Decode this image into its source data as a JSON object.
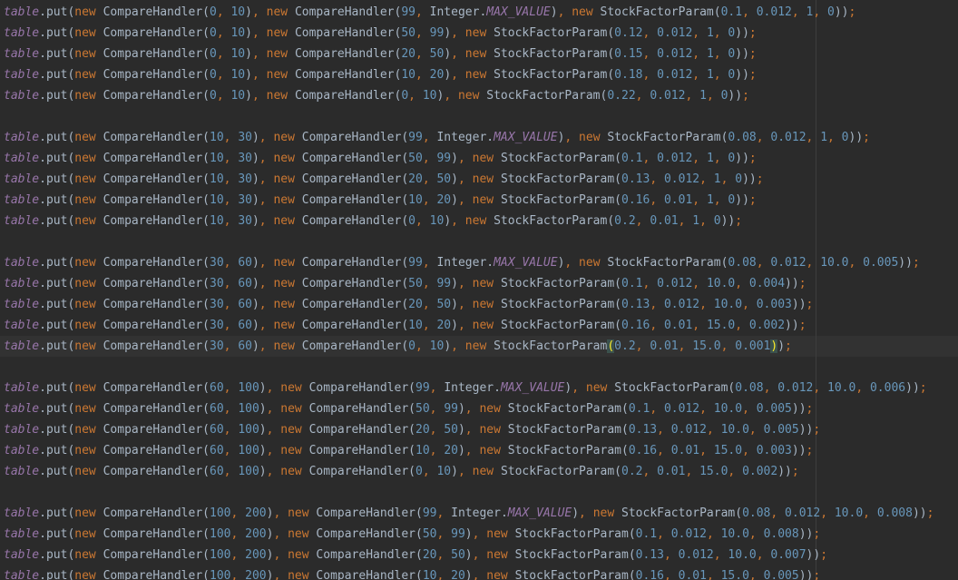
{
  "editor": {
    "lines": [
      {
        "map_var": "table",
        "method": "put",
        "kw": "new",
        "cls_a": "CompareHandler",
        "a1": "0",
        "a2": "10",
        "cls_b": "CompareHandler",
        "b1": "99",
        "b2_type": "Integer",
        "b2_const": "MAX_VALUE",
        "b2": "",
        "cls_c": "StockFactorParam",
        "c1": "0.1",
        "c2": "0.012",
        "c3": "1",
        "c4": "0"
      },
      {
        "map_var": "table",
        "method": "put",
        "kw": "new",
        "cls_a": "CompareHandler",
        "a1": "0",
        "a2": "10",
        "cls_b": "CompareHandler",
        "b1": "50",
        "b2_type": "",
        "b2_const": "",
        "b2": "99",
        "cls_c": "StockFactorParam",
        "c1": "0.12",
        "c2": "0.012",
        "c3": "1",
        "c4": "0"
      },
      {
        "map_var": "table",
        "method": "put",
        "kw": "new",
        "cls_a": "CompareHandler",
        "a1": "0",
        "a2": "10",
        "cls_b": "CompareHandler",
        "b1": "20",
        "b2_type": "",
        "b2_const": "",
        "b2": "50",
        "cls_c": "StockFactorParam",
        "c1": "0.15",
        "c2": "0.012",
        "c3": "1",
        "c4": "0"
      },
      {
        "map_var": "table",
        "method": "put",
        "kw": "new",
        "cls_a": "CompareHandler",
        "a1": "0",
        "a2": "10",
        "cls_b": "CompareHandler",
        "b1": "10",
        "b2_type": "",
        "b2_const": "",
        "b2": "20",
        "cls_c": "StockFactorParam",
        "c1": "0.18",
        "c2": "0.012",
        "c3": "1",
        "c4": "0"
      },
      {
        "map_var": "table",
        "method": "put",
        "kw": "new",
        "cls_a": "CompareHandler",
        "a1": "0",
        "a2": "10",
        "cls_b": "CompareHandler",
        "b1": "0",
        "b2_type": "",
        "b2_const": "",
        "b2": "10",
        "cls_c": "StockFactorParam",
        "c1": "0.22",
        "c2": "0.012",
        "c3": "1",
        "c4": "0"
      },
      null,
      {
        "map_var": "table",
        "method": "put",
        "kw": "new",
        "cls_a": "CompareHandler",
        "a1": "10",
        "a2": "30",
        "cls_b": "CompareHandler",
        "b1": "99",
        "b2_type": "Integer",
        "b2_const": "MAX_VALUE",
        "b2": "",
        "cls_c": "StockFactorParam",
        "c1": "0.08",
        "c2": "0.012",
        "c3": "1",
        "c4": "0"
      },
      {
        "map_var": "table",
        "method": "put",
        "kw": "new",
        "cls_a": "CompareHandler",
        "a1": "10",
        "a2": "30",
        "cls_b": "CompareHandler",
        "b1": "50",
        "b2_type": "",
        "b2_const": "",
        "b2": "99",
        "cls_c": "StockFactorParam",
        "c1": "0.1",
        "c2": "0.012",
        "c3": "1",
        "c4": "0"
      },
      {
        "map_var": "table",
        "method": "put",
        "kw": "new",
        "cls_a": "CompareHandler",
        "a1": "10",
        "a2": "30",
        "cls_b": "CompareHandler",
        "b1": "20",
        "b2_type": "",
        "b2_const": "",
        "b2": "50",
        "cls_c": "StockFactorParam",
        "c1": "0.13",
        "c2": "0.012",
        "c3": "1",
        "c4": "0"
      },
      {
        "map_var": "table",
        "method": "put",
        "kw": "new",
        "cls_a": "CompareHandler",
        "a1": "10",
        "a2": "30",
        "cls_b": "CompareHandler",
        "b1": "10",
        "b2_type": "",
        "b2_const": "",
        "b2": "20",
        "cls_c": "StockFactorParam",
        "c1": "0.16",
        "c2": "0.01",
        "c3": "1",
        "c4": "0"
      },
      {
        "map_var": "table",
        "method": "put",
        "kw": "new",
        "cls_a": "CompareHandler",
        "a1": "10",
        "a2": "30",
        "cls_b": "CompareHandler",
        "b1": "0",
        "b2_type": "",
        "b2_const": "",
        "b2": "10",
        "cls_c": "StockFactorParam",
        "c1": "0.2",
        "c2": "0.01",
        "c3": "1",
        "c4": "0"
      },
      null,
      {
        "map_var": "table",
        "method": "put",
        "kw": "new",
        "cls_a": "CompareHandler",
        "a1": "30",
        "a2": "60",
        "cls_b": "CompareHandler",
        "b1": "99",
        "b2_type": "Integer",
        "b2_const": "MAX_VALUE",
        "b2": "",
        "cls_c": "StockFactorParam",
        "c1": "0.08",
        "c2": "0.012",
        "c3": "10.0",
        "c4": "0.005"
      },
      {
        "map_var": "table",
        "method": "put",
        "kw": "new",
        "cls_a": "CompareHandler",
        "a1": "30",
        "a2": "60",
        "cls_b": "CompareHandler",
        "b1": "50",
        "b2_type": "",
        "b2_const": "",
        "b2": "99",
        "cls_c": "StockFactorParam",
        "c1": "0.1",
        "c2": "0.012",
        "c3": "10.0",
        "c4": "0.004"
      },
      {
        "map_var": "table",
        "method": "put",
        "kw": "new",
        "cls_a": "CompareHandler",
        "a1": "30",
        "a2": "60",
        "cls_b": "CompareHandler",
        "b1": "20",
        "b2_type": "",
        "b2_const": "",
        "b2": "50",
        "cls_c": "StockFactorParam",
        "c1": "0.13",
        "c2": "0.012",
        "c3": "10.0",
        "c4": "0.003"
      },
      {
        "map_var": "table",
        "method": "put",
        "kw": "new",
        "cls_a": "CompareHandler",
        "a1": "30",
        "a2": "60",
        "cls_b": "CompareHandler",
        "b1": "10",
        "b2_type": "",
        "b2_const": "",
        "b2": "20",
        "cls_c": "StockFactorParam",
        "c1": "0.16",
        "c2": "0.01",
        "c3": "15.0",
        "c4": "0.002"
      },
      {
        "map_var": "table",
        "method": "put",
        "kw": "new",
        "cls_a": "CompareHandler",
        "a1": "30",
        "a2": "60",
        "cls_b": "CompareHandler",
        "b1": "0",
        "b2_type": "",
        "b2_const": "",
        "b2": "10",
        "cls_c": "StockFactorParam",
        "c1": "0.2",
        "c2": "0.01",
        "c3": "15.0",
        "c4": "0.001",
        "current": true
      },
      null,
      {
        "map_var": "table",
        "method": "put",
        "kw": "new",
        "cls_a": "CompareHandler",
        "a1": "60",
        "a2": "100",
        "cls_b": "CompareHandler",
        "b1": "99",
        "b2_type": "Integer",
        "b2_const": "MAX_VALUE",
        "b2": "",
        "cls_c": "StockFactorParam",
        "c1": "0.08",
        "c2": "0.012",
        "c3": "10.0",
        "c4": "0.006"
      },
      {
        "map_var": "table",
        "method": "put",
        "kw": "new",
        "cls_a": "CompareHandler",
        "a1": "60",
        "a2": "100",
        "cls_b": "CompareHandler",
        "b1": "50",
        "b2_type": "",
        "b2_const": "",
        "b2": "99",
        "cls_c": "StockFactorParam",
        "c1": "0.1",
        "c2": "0.012",
        "c3": "10.0",
        "c4": "0.005"
      },
      {
        "map_var": "table",
        "method": "put",
        "kw": "new",
        "cls_a": "CompareHandler",
        "a1": "60",
        "a2": "100",
        "cls_b": "CompareHandler",
        "b1": "20",
        "b2_type": "",
        "b2_const": "",
        "b2": "50",
        "cls_c": "StockFactorParam",
        "c1": "0.13",
        "c2": "0.012",
        "c3": "10.0",
        "c4": "0.005"
      },
      {
        "map_var": "table",
        "method": "put",
        "kw": "new",
        "cls_a": "CompareHandler",
        "a1": "60",
        "a2": "100",
        "cls_b": "CompareHandler",
        "b1": "10",
        "b2_type": "",
        "b2_const": "",
        "b2": "20",
        "cls_c": "StockFactorParam",
        "c1": "0.16",
        "c2": "0.01",
        "c3": "15.0",
        "c4": "0.003"
      },
      {
        "map_var": "table",
        "method": "put",
        "kw": "new",
        "cls_a": "CompareHandler",
        "a1": "60",
        "a2": "100",
        "cls_b": "CompareHandler",
        "b1": "0",
        "b2_type": "",
        "b2_const": "",
        "b2": "10",
        "cls_c": "StockFactorParam",
        "c1": "0.2",
        "c2": "0.01",
        "c3": "15.0",
        "c4": "0.002"
      },
      null,
      {
        "map_var": "table",
        "method": "put",
        "kw": "new",
        "cls_a": "CompareHandler",
        "a1": "100",
        "a2": "200",
        "cls_b": "CompareHandler",
        "b1": "99",
        "b2_type": "Integer",
        "b2_const": "MAX_VALUE",
        "b2": "",
        "cls_c": "StockFactorParam",
        "c1": "0.08",
        "c2": "0.012",
        "c3": "10.0",
        "c4": "0.008"
      },
      {
        "map_var": "table",
        "method": "put",
        "kw": "new",
        "cls_a": "CompareHandler",
        "a1": "100",
        "a2": "200",
        "cls_b": "CompareHandler",
        "b1": "50",
        "b2_type": "",
        "b2_const": "",
        "b2": "99",
        "cls_c": "StockFactorParam",
        "c1": "0.1",
        "c2": "0.012",
        "c3": "10.0",
        "c4": "0.008"
      },
      {
        "map_var": "table",
        "method": "put",
        "kw": "new",
        "cls_a": "CompareHandler",
        "a1": "100",
        "a2": "200",
        "cls_b": "CompareHandler",
        "b1": "20",
        "b2_type": "",
        "b2_const": "",
        "b2": "50",
        "cls_c": "StockFactorParam",
        "c1": "0.13",
        "c2": "0.012",
        "c3": "10.0",
        "c4": "0.007"
      },
      {
        "map_var": "table",
        "method": "put",
        "kw": "new",
        "cls_a": "CompareHandler",
        "a1": "100",
        "a2": "200",
        "cls_b": "CompareHandler",
        "b1": "10",
        "b2_type": "",
        "b2_const": "",
        "b2": "20",
        "cls_c": "StockFactorParam",
        "c1": "0.16",
        "c2": "0.01",
        "c3": "15.0",
        "c4": "0.005"
      }
    ]
  }
}
